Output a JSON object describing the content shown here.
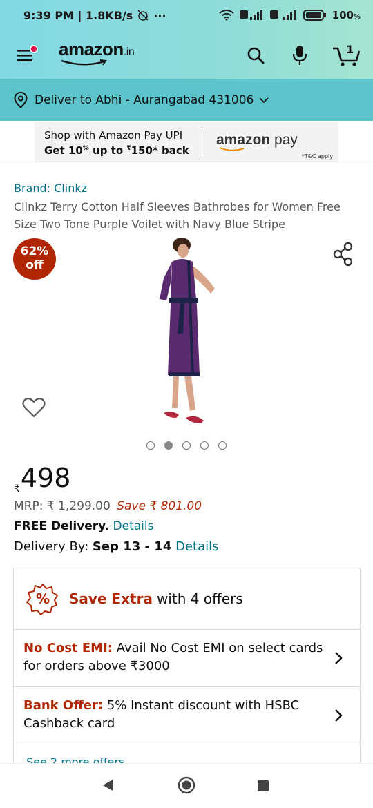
{
  "status_bar": {
    "time": "9:39 PM | 1.8KB/s",
    "dots": "···",
    "battery": "100",
    "battery_unit": "%"
  },
  "header": {
    "logo_text": "amazon",
    "logo_tld": ".in",
    "cart_count": "1",
    "icons": [
      "menu-icon",
      "search-icon",
      "microphone-icon",
      "cart-icon"
    ]
  },
  "delivery": {
    "text": "Deliver to Abhi - Aurangabad 431006"
  },
  "promo_banner": {
    "line1": "Shop with Amazon Pay UPI",
    "line2_prefix": "Get 10",
    "line2_pct": "%",
    "line2_mid": " up to ",
    "line2_rupee": "₹",
    "line2_amt": "150*",
    "line2_suffix": " back",
    "right_brand": "amazon",
    "right_pay": " pay",
    "note": "*T&C apply"
  },
  "product": {
    "brand": "Brand: Clinkz",
    "title": "Clinkz Terry Cotton Half Sleeves Bathrobes for Women Free Size Two Tone Purple Voilet with Navy Blue Stripe",
    "discount_pct": "62%",
    "discount_word": "off",
    "image_count": 5,
    "active_image_index": 1
  },
  "pricing": {
    "currency_symbol": "₹",
    "price": "498",
    "mrp_label": "MRP: ",
    "mrp_value": "₹ 1,299.00",
    "save_text": "Save ₹ 801.00",
    "free_delivery": "FREE Delivery.",
    "free_delivery_link": " Details",
    "delivery_by_label": "Delivery By: ",
    "delivery_by_date": "Sep 13 - 14",
    "delivery_by_link": " Details"
  },
  "offers": {
    "head_highlight": "Save Extra",
    "head_rest": "with 4 offers",
    "rows": [
      {
        "label": "No Cost EMI:",
        "text": " Avail No Cost EMI on select cards for orders above ₹3000"
      },
      {
        "label": "Bank Offer:",
        "text": " 5% Instant discount with HSBC Cashback card"
      }
    ],
    "more_partial": "See 2 more offers"
  },
  "colors": {
    "header_gradient_start": "#82d8e3",
    "delivery_bar": "#5dc4cc",
    "link": "#007185",
    "deal_red": "#b12704"
  }
}
